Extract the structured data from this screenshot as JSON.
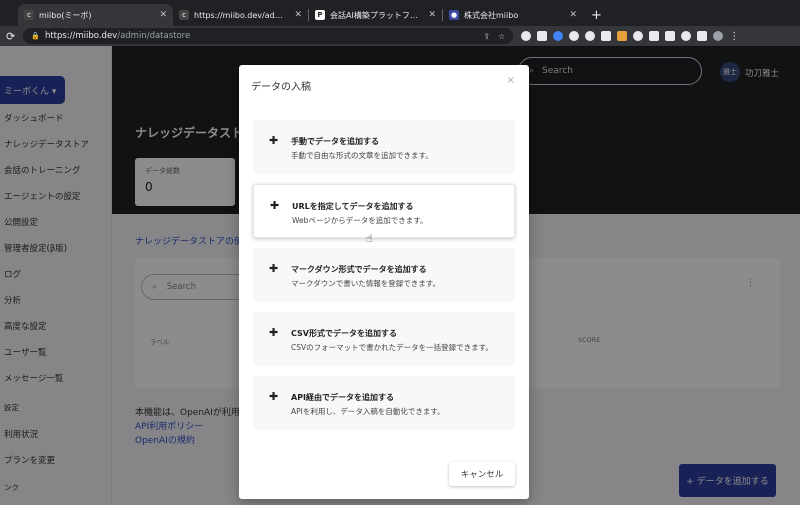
{
  "browser": {
    "tabs": [
      {
        "title": "miibo(ミーボ)",
        "active": true
      },
      {
        "title": "https://miibo.dev/admin/previe"
      },
      {
        "title": "会話AI構築プラットフォーム「mii"
      },
      {
        "title": "株式会社miibo"
      }
    ],
    "url_host": "https://miibo.dev",
    "url_path": "/admin/datastore"
  },
  "app": {
    "brand_button": "ミーボくん ▾",
    "sidebar_items": [
      "ダッシュボード",
      "ナレッジデータストア",
      "会話のトレーニング",
      "エージェントの設定",
      "公開設定",
      "管理者設定(β版)",
      "ログ",
      "分析",
      "高度な設定",
      "ユーザ一覧",
      "メッセージ一覧",
      "設定",
      "利用状況",
      "プランを変更",
      "ンク"
    ],
    "search_placeholder": "Search",
    "avatar_text": "雅士",
    "username": "功刀雅士",
    "page_title": "ナレッジデータスト",
    "stat_label": "データ総数",
    "stat_value": "0",
    "link_text": "ナレッジデータストアの使",
    "panel_search_placeholder": "Search",
    "col_label": "ラベル",
    "col_score": "SCORE",
    "note_line1": "本機能は、OpenAIが利用",
    "note_line2": "API利用ポリシー",
    "note_line3": "OpenAIの規約",
    "add_data_button": "+ データを追加する"
  },
  "modal": {
    "title": "データの入稿",
    "close": "×",
    "options": [
      {
        "title": "手動でデータを追加する",
        "desc": "手動で自由な形式の文章を追加できます。"
      },
      {
        "title": "URLを指定してデータを追加する",
        "desc": "Webページからデータを追加できます。"
      },
      {
        "title": "マークダウン形式でデータを追加する",
        "desc": "マークダウンで書いた情報を登録できます。"
      },
      {
        "title": "CSV形式でデータを追加する",
        "desc": "CSVのフォーマットで書かれたデータを一括登録できます。"
      },
      {
        "title": "API経由でデータを追加する",
        "desc": "APIを利用し、データ入稿を自動化できます。"
      }
    ],
    "cancel_label": "キャンセル"
  }
}
